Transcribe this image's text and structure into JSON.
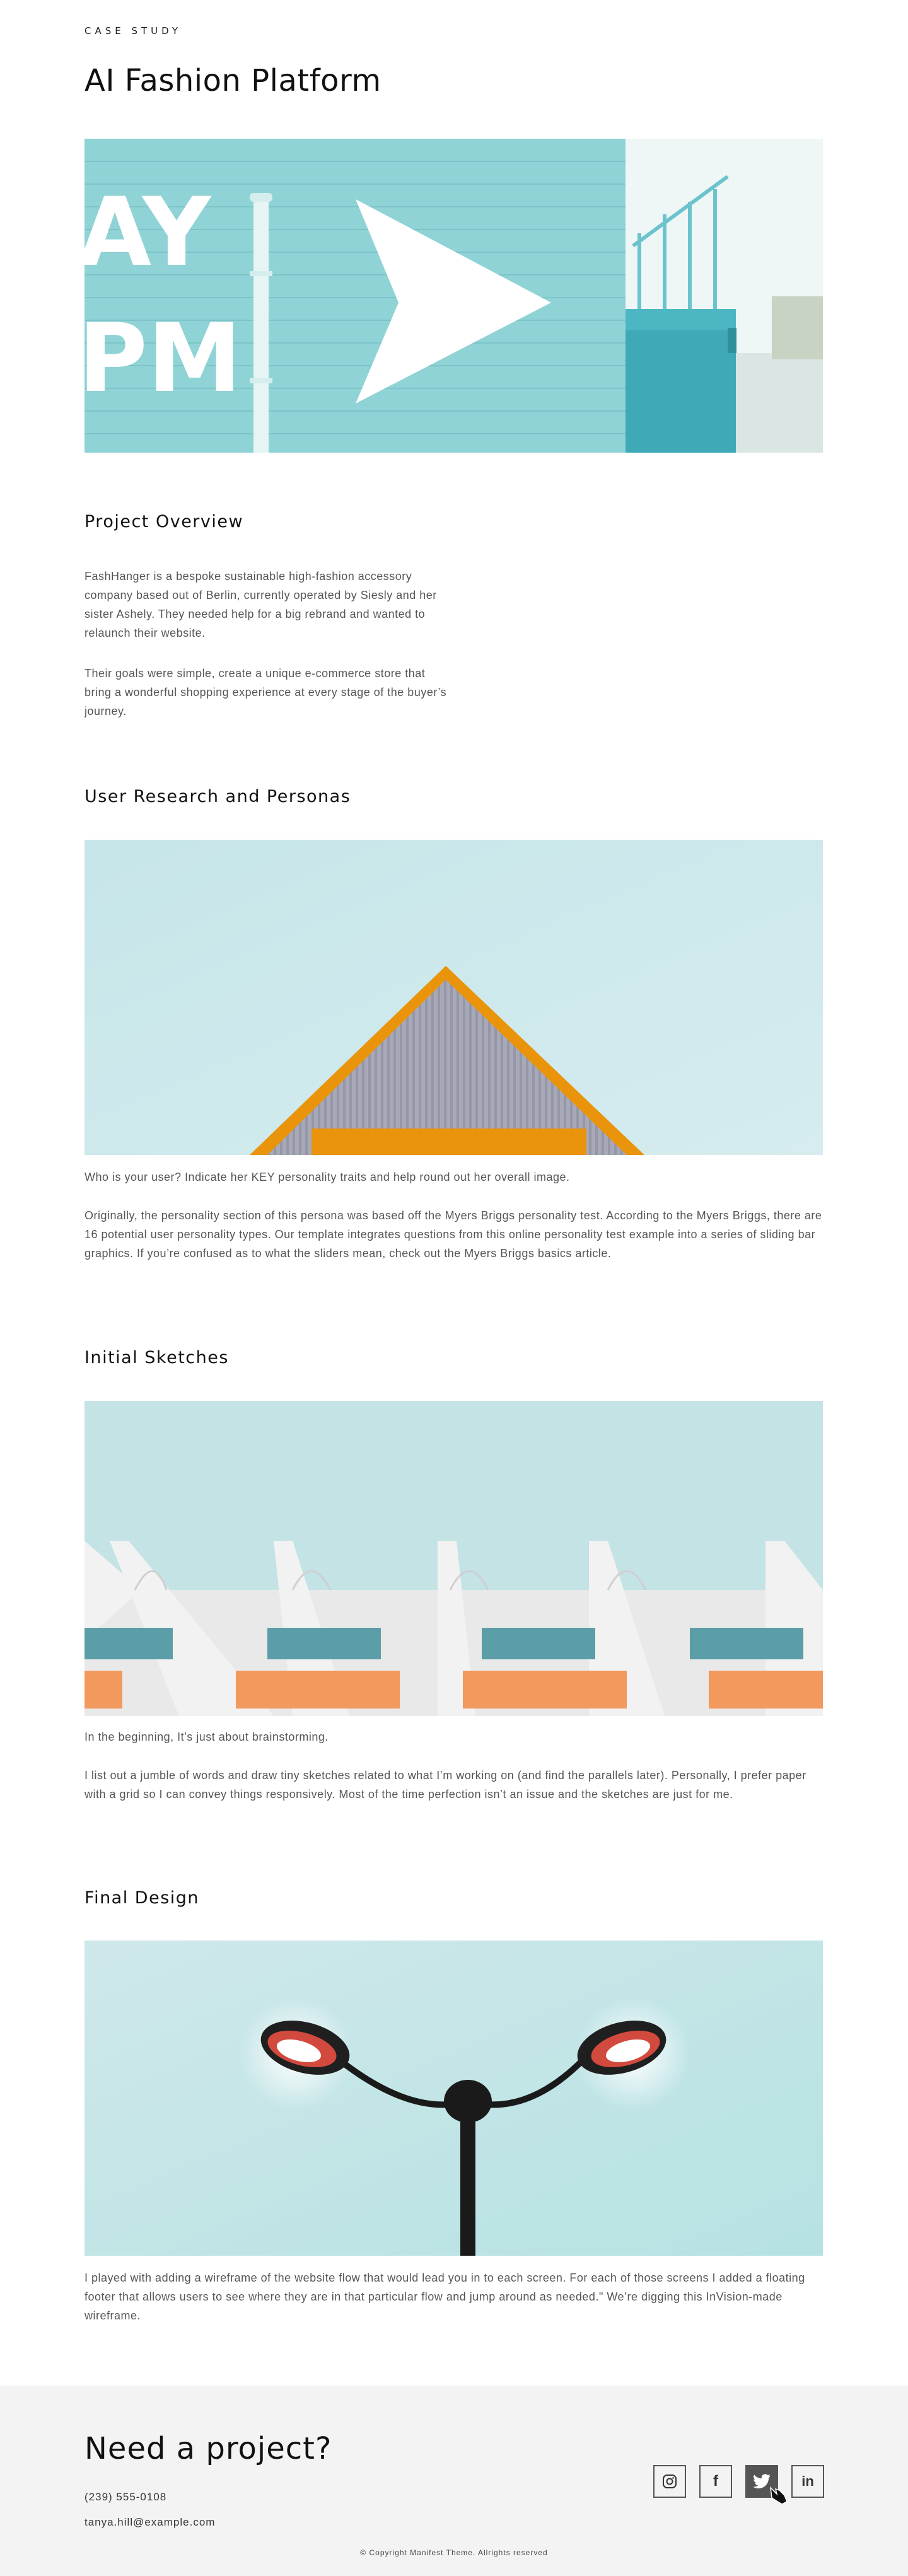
{
  "header": {
    "eyebrow": "CASE STUDY",
    "title": "AI Fashion Platform"
  },
  "hero": {
    "sign_text_1": "AY",
    "sign_text_2": "PM"
  },
  "overview": {
    "title": "Project Overview",
    "paragraph_1": "FashHanger is a bespoke sustainable high-fashion accessory company based out of Berlin, currently operated by Siesly and her sister Ashely. They needed help for a big rebrand and wanted to relaunch their website.",
    "paragraph_2": "Their goals were simple, create a unique e-commerce store that bring a wonderful shopping experience at every stage of the buyer’s journey."
  },
  "research": {
    "title": "User Research and Personas",
    "caption": "Who is your user? Indicate her KEY personality traits and help round out her overall image.",
    "paragraph": "Originally, the personality section of this persona was based off the Myers Briggs personality test. According to the Myers Briggs, there are 16 potential user personality types. Our template integrates questions from this online personality test example into a series of sliding bar graphics. If you’re confused as to what the sliders mean, check out the Myers Briggs basics article."
  },
  "sketches": {
    "title": "Initial Sketches",
    "caption": "In the beginning, It’s just about brainstorming.",
    "paragraph": "I list out a jumble of words and draw tiny sketches related to what I’m working on (and find the parallels later). Personally, I prefer paper with a grid so I can convey things responsively. Most of the time perfection isn’t an issue and the sketches are just for me."
  },
  "final": {
    "title": "Final Design",
    "paragraph": "I played with adding a wireframe of the website flow that would lead you in to each screen. For each of those screens I added a floating footer that allows users to see where they are in that particular flow and jump around as needed.\" We’re digging this InVision-made wireframe."
  },
  "footer": {
    "title": "Need a project?",
    "phone": "(239) 555-0108",
    "email": "tanya.hill@example.com",
    "copyright": "© Copyright Manifest Theme. Allrights reserved",
    "social": [
      {
        "name": "instagram-icon",
        "glyph": "◎"
      },
      {
        "name": "facebook-icon",
        "glyph": "f"
      },
      {
        "name": "twitter-icon",
        "glyph": "🐦"
      },
      {
        "name": "linkedin-icon",
        "glyph": "in"
      }
    ]
  },
  "colors": {
    "teal_wall": "#8fd3d6",
    "sky": "#cfe9ec",
    "roof_orange": "#e9940b",
    "footer_bg": "#f3f3f3"
  }
}
